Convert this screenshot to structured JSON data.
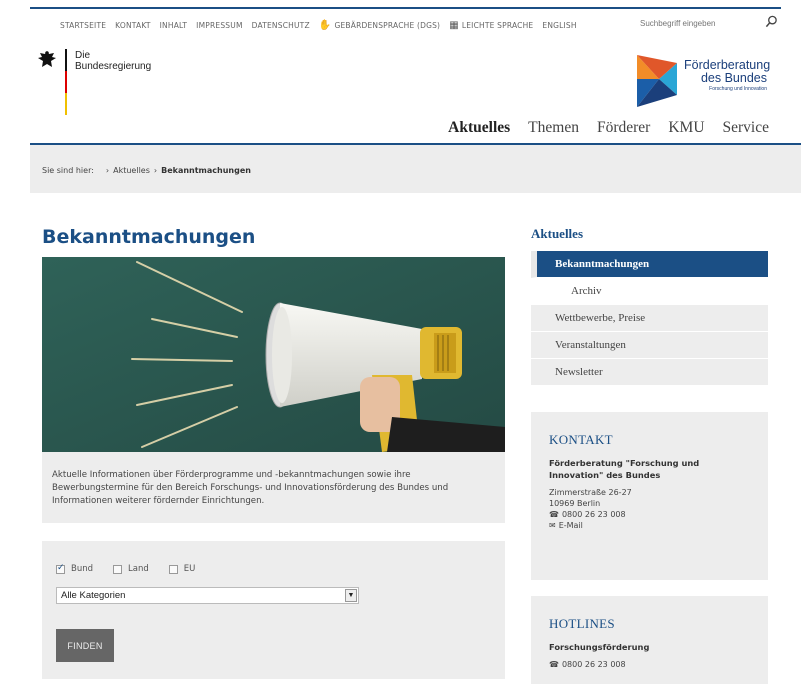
{
  "meta_nav": [
    "STARTSEITE",
    "KONTAKT",
    "INHALT",
    "IMPRESSUM",
    "DATENSCHUTZ",
    "GEBÄRDENSPRACHE (DGS)",
    "LEICHTE SPRACHE",
    "ENGLISH"
  ],
  "search": {
    "placeholder": "Suchbegriff eingeben",
    "icon": "magnifier-icon"
  },
  "logo_bund": {
    "line1": "Die",
    "line2": "Bundesregierung"
  },
  "logo_foerder": {
    "line1": "Förderberatung",
    "line2": "des Bundes",
    "line3": "Forschung und Innovation"
  },
  "main_nav": [
    "Aktuelles",
    "Themen",
    "Förderer",
    "KMU",
    "Service"
  ],
  "breadcrumb": {
    "label": "Sie sind hier:",
    "items": [
      "Aktuelles",
      "Bekanntmachungen"
    ]
  },
  "page_title": "Bekanntmachungen",
  "intro_text": "Aktuelle Informationen über Förderprogramme und -bekanntmachungen sowie ihre Bewerbungstermine für den Bereich Forschungs- und Innovationsförderung des Bundes und Informationen weiterer fördernder Einrichtungen.",
  "filter": {
    "checkboxes": [
      {
        "label": "Bund",
        "checked": true
      },
      {
        "label": "Land",
        "checked": false
      },
      {
        "label": "EU",
        "checked": false
      }
    ],
    "select_value": "Alle Kategorien",
    "button": "FINDEN"
  },
  "sidebar": {
    "title": "Aktuelles",
    "items": [
      "Bekanntmachungen",
      "Archiv",
      "Wettbewerbe, Preise",
      "Veranstaltungen",
      "Newsletter"
    ]
  },
  "kontakt": {
    "title": "KONTAKT",
    "org": "Förderberatung \"Forschung und Innovation\" des Bundes",
    "street": "Zimmerstraße 26-27",
    "city": "10969 Berlin",
    "phone": "0800 26 23 008",
    "email": "E-Mail"
  },
  "hotlines": {
    "title": "HOTLINES",
    "subtitle": "Forschungsförderung",
    "phone": "0800 26 23 008"
  },
  "colors": {
    "accent": "#1b4f85",
    "panel": "#ededed"
  }
}
